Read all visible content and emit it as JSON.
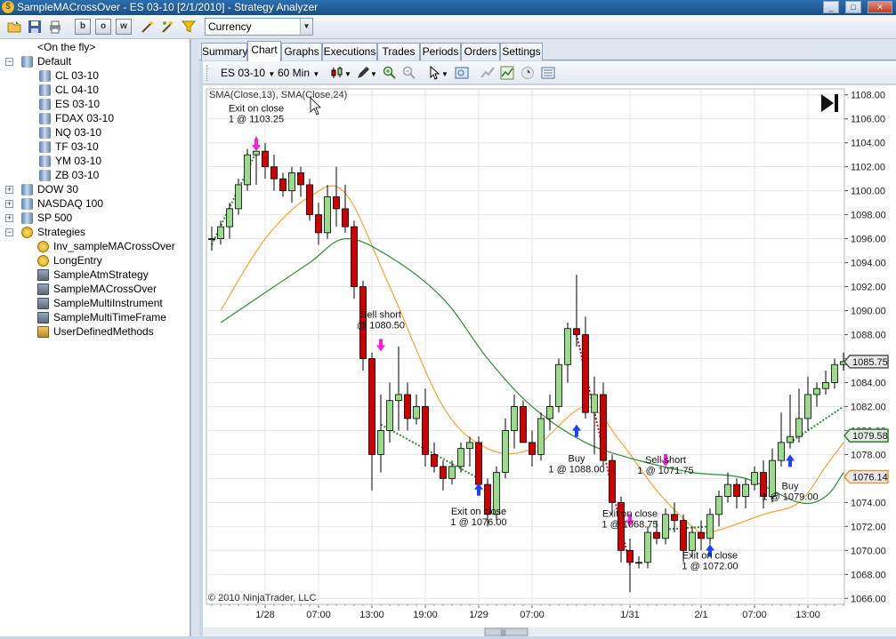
{
  "window": {
    "title": "SampleMACrossOver - ES 03-10 [2/1/2010] - Strategy Analyzer"
  },
  "toolbar": {
    "format_b": "b",
    "format_o": "o",
    "format_w": "w",
    "currency_select": "Currency"
  },
  "tree": [
    {
      "label": "<On the fly>",
      "level": 1,
      "icon": "db-icon",
      "expander": ""
    },
    {
      "label": "Default",
      "level": 0,
      "icon": "db-icon",
      "expander": "−"
    },
    {
      "label": "CL 03-10",
      "level": 2,
      "icon": "db-icon",
      "expander": ""
    },
    {
      "label": "CL 04-10",
      "level": 2,
      "icon": "db-icon",
      "expander": ""
    },
    {
      "label": "ES 03-10",
      "level": 2,
      "icon": "db-icon",
      "expander": ""
    },
    {
      "label": "FDAX 03-10",
      "level": 2,
      "icon": "db-icon",
      "expander": ""
    },
    {
      "label": "NQ 03-10",
      "level": 2,
      "icon": "db-icon",
      "expander": ""
    },
    {
      "label": "TF 03-10",
      "level": 2,
      "icon": "db-icon",
      "expander": ""
    },
    {
      "label": "YM 03-10",
      "level": 2,
      "icon": "db-icon",
      "expander": ""
    },
    {
      "label": "ZB 03-10",
      "level": 2,
      "icon": "db-icon",
      "expander": ""
    },
    {
      "label": "DOW 30",
      "level": 0,
      "icon": "db-icon",
      "expander": "+"
    },
    {
      "label": "NASDAQ 100",
      "level": 0,
      "icon": "db-icon",
      "expander": "+"
    },
    {
      "label": "SP 500",
      "level": 0,
      "icon": "db-icon",
      "expander": "+"
    },
    {
      "label": "Strategies",
      "level": 0,
      "icon": "coin-icon",
      "expander": "−"
    },
    {
      "label": "Inv_sampleMACrossOver",
      "level": 1,
      "icon": "coin-icon",
      "expander": ""
    },
    {
      "label": "LongEntry",
      "level": 1,
      "icon": "coin-icon",
      "expander": ""
    },
    {
      "label": "SampleAtmStrategy",
      "level": 1,
      "icon": "strategy-icon",
      "expander": ""
    },
    {
      "label": "SampleMACrossOver",
      "level": 1,
      "icon": "strategy-icon",
      "expander": ""
    },
    {
      "label": "SampleMultiInstrument",
      "level": 1,
      "icon": "strategy-icon",
      "expander": ""
    },
    {
      "label": "SampleMultiTimeFrame",
      "level": 1,
      "icon": "strategy-icon",
      "expander": ""
    },
    {
      "label": "UserDefinedMethods",
      "level": 1,
      "icon": "box-icon",
      "expander": ""
    }
  ],
  "tabs": [
    "Summary",
    "Chart",
    "Graphs",
    "Executions",
    "Trades",
    "Periods",
    "Orders",
    "Settings"
  ],
  "active_tab": "Chart",
  "chart_toolbar": {
    "instrument": "ES 03-10",
    "interval": "60 Min"
  },
  "chart_data": {
    "type": "candlestick",
    "indicator_label": "SMA(Close,13), SMA(Close,24)",
    "copyright": "© 2010 NinjaTrader, LLC",
    "ylim": [
      1065.5,
      1108.5
    ],
    "y_ticks": [
      "1066.00",
      "1068.00",
      "1070.00",
      "1072.00",
      "1074.00",
      "1076.00",
      "1078.00",
      "1080.00",
      "1082.00",
      "1084.00",
      "1086.00",
      "1088.00",
      "1090.00",
      "1092.00",
      "1094.00",
      "1096.00",
      "1098.00",
      "1100.00",
      "1102.00",
      "1104.00",
      "1106.00",
      "1108.00"
    ],
    "x_ticks": [
      {
        "bar": 6,
        "label": "1/28"
      },
      {
        "bar": 12,
        "label": "07:00"
      },
      {
        "bar": 18,
        "label": "13:00"
      },
      {
        "bar": 24,
        "label": "19:00"
      },
      {
        "bar": 30,
        "label": "1/29"
      },
      {
        "bar": 36,
        "label": "07:00"
      },
      {
        "bar": 47,
        "label": "1/31"
      },
      {
        "bar": 55,
        "label": "2/1"
      },
      {
        "bar": 61,
        "label": "07:00"
      },
      {
        "bar": 67,
        "label": "13:00"
      }
    ],
    "price_badges": [
      {
        "value": 1085.75,
        "label": "1085.75",
        "color": "#555555"
      },
      {
        "value": 1079.58,
        "label": "1079.58",
        "color": "#2e7d32"
      },
      {
        "value": 1076.14,
        "label": "1076.14",
        "color": "#ef9a1e"
      }
    ],
    "candles": [
      [
        1096.0,
        1097.0,
        1095.0,
        1096.0
      ],
      [
        1096.0,
        1097.5,
        1095.5,
        1097.0
      ],
      [
        1097.0,
        1099.0,
        1096.0,
        1098.5
      ],
      [
        1098.5,
        1101.0,
        1098.0,
        1100.5
      ],
      [
        1100.5,
        1103.5,
        1100.0,
        1103.0
      ],
      [
        1103.0,
        1104.5,
        1100.5,
        1103.3
      ],
      [
        1103.3,
        1104.0,
        1101.0,
        1102.0
      ],
      [
        1102.0,
        1103.0,
        1100.0,
        1101.0
      ],
      [
        1101.0,
        1101.5,
        1099.5,
        1100.0
      ],
      [
        1100.0,
        1102.0,
        1099.0,
        1101.5
      ],
      [
        1101.5,
        1102.0,
        1099.5,
        1100.5
      ],
      [
        1100.5,
        1101.0,
        1097.5,
        1098.0
      ],
      [
        1098.0,
        1099.0,
        1095.5,
        1096.5
      ],
      [
        1096.5,
        1100.5,
        1096.0,
        1099.5
      ],
      [
        1099.5,
        1102.0,
        1097.0,
        1098.5
      ],
      [
        1098.5,
        1100.5,
        1096.5,
        1097.0
      ],
      [
        1097.0,
        1097.5,
        1091.0,
        1092.0
      ],
      [
        1092.0,
        1092.5,
        1085.0,
        1086.0
      ],
      [
        1086.0,
        1086.5,
        1075.0,
        1078.0
      ],
      [
        1078.0,
        1083.0,
        1076.5,
        1080.0
      ],
      [
        1080.0,
        1084.0,
        1079.0,
        1082.5
      ],
      [
        1082.5,
        1087.0,
        1080.0,
        1083.0
      ],
      [
        1083.0,
        1084.0,
        1080.0,
        1081.0
      ],
      [
        1081.0,
        1083.0,
        1080.5,
        1082.0
      ],
      [
        1082.0,
        1083.5,
        1077.0,
        1078.0
      ],
      [
        1078.0,
        1079.0,
        1076.5,
        1077.0
      ],
      [
        1077.0,
        1077.5,
        1075.0,
        1076.0
      ],
      [
        1076.0,
        1077.5,
        1075.5,
        1077.0
      ],
      [
        1077.0,
        1079.0,
        1076.5,
        1078.5
      ],
      [
        1078.5,
        1079.5,
        1077.0,
        1079.0
      ],
      [
        1079.0,
        1079.5,
        1075.5,
        1075.5
      ],
      [
        1075.5,
        1076.0,
        1072.0,
        1073.0
      ],
      [
        1073.0,
        1077.0,
        1072.5,
        1076.5
      ],
      [
        1076.5,
        1081.0,
        1076.0,
        1080.0
      ],
      [
        1080.0,
        1083.0,
        1078.5,
        1082.0
      ],
      [
        1082.0,
        1082.5,
        1079.0,
        1079.0
      ],
      [
        1079.0,
        1080.0,
        1077.0,
        1078.0
      ],
      [
        1078.0,
        1081.5,
        1077.5,
        1081.0
      ],
      [
        1081.0,
        1083.0,
        1080.0,
        1082.0
      ],
      [
        1082.0,
        1086.0,
        1081.5,
        1085.5
      ],
      [
        1085.5,
        1089.0,
        1084.0,
        1088.5
      ],
      [
        1088.5,
        1093.0,
        1087.0,
        1088.0
      ],
      [
        1088.0,
        1089.5,
        1081.0,
        1081.5
      ],
      [
        1081.5,
        1084.5,
        1078.0,
        1083.0
      ],
      [
        1083.0,
        1084.0,
        1077.0,
        1077.5
      ],
      [
        1077.5,
        1078.0,
        1073.0,
        1074.0
      ],
      [
        1074.0,
        1074.5,
        1069.0,
        1070.0
      ],
      [
        1070.0,
        1071.0,
        1066.5,
        1069.0
      ],
      [
        1069.0,
        1069.5,
        1068.5,
        1069.0
      ],
      [
        1069.0,
        1072.0,
        1068.5,
        1071.5
      ],
      [
        1071.5,
        1072.5,
        1070.5,
        1071.0
      ],
      [
        1071.0,
        1073.5,
        1070.5,
        1073.0
      ],
      [
        1073.0,
        1074.0,
        1071.5,
        1072.5
      ],
      [
        1072.5,
        1073.0,
        1069.0,
        1070.0
      ],
      [
        1070.0,
        1072.0,
        1069.5,
        1071.5
      ],
      [
        1071.5,
        1072.5,
        1070.0,
        1071.0
      ],
      [
        1071.0,
        1073.5,
        1070.5,
        1073.0
      ],
      [
        1073.0,
        1075.0,
        1072.0,
        1074.5
      ],
      [
        1074.5,
        1076.5,
        1074.0,
        1075.5
      ],
      [
        1075.5,
        1076.0,
        1073.5,
        1074.5
      ],
      [
        1074.5,
        1076.0,
        1073.5,
        1075.5
      ],
      [
        1075.5,
        1077.0,
        1075.0,
        1076.5
      ],
      [
        1076.5,
        1077.5,
        1073.5,
        1074.5
      ],
      [
        1074.5,
        1078.5,
        1074.0,
        1077.5
      ],
      [
        1077.5,
        1081.5,
        1077.0,
        1079.0
      ],
      [
        1079.0,
        1083.0,
        1078.5,
        1079.5
      ],
      [
        1079.5,
        1083.5,
        1079.0,
        1081.0
      ],
      [
        1081.0,
        1084.5,
        1080.0,
        1083.0
      ],
      [
        1083.0,
        1084.0,
        1082.0,
        1083.5
      ],
      [
        1083.5,
        1085.0,
        1083.0,
        1084.0
      ],
      [
        1084.0,
        1086.0,
        1083.5,
        1085.5
      ],
      [
        1085.5,
        1086.5,
        1085.0,
        1085.75
      ]
    ],
    "series": [
      {
        "name": "SMA(Close,13)",
        "color": "#f0a535",
        "points": [
          [
            1,
            1090.0
          ],
          [
            6,
            1096.0
          ],
          [
            11,
            1099.5
          ],
          [
            15,
            1099.8
          ],
          [
            20,
            1092.0
          ],
          [
            26,
            1082.0
          ],
          [
            31,
            1078.5
          ],
          [
            36,
            1078.5
          ],
          [
            42,
            1082.0
          ],
          [
            46,
            1079.0
          ],
          [
            50,
            1075.0
          ],
          [
            54,
            1072.0
          ],
          [
            56,
            1071.5
          ],
          [
            62,
            1073.0
          ],
          [
            66,
            1074.0
          ],
          [
            69,
            1077.0
          ],
          [
            71,
            1079.0
          ]
        ]
      },
      {
        "name": "SMA(Close,24)",
        "color": "#2e8b34",
        "points": [
          [
            1,
            1089.0
          ],
          [
            6,
            1091.5
          ],
          [
            11,
            1094.0
          ],
          [
            15,
            1096.0
          ],
          [
            20,
            1094.5
          ],
          [
            26,
            1091.0
          ],
          [
            31,
            1086.0
          ],
          [
            36,
            1082.0
          ],
          [
            42,
            1079.0
          ],
          [
            48,
            1077.5
          ],
          [
            54,
            1076.5
          ],
          [
            60,
            1076.0
          ],
          [
            66,
            1074.0
          ],
          [
            69,
            1074.5
          ],
          [
            71,
            1076.5
          ]
        ]
      }
    ],
    "trades": [
      {
        "from": 0,
        "from_price": 1095.5,
        "to": 5,
        "to_price": 1103.25
      },
      {
        "from": 19,
        "from_price": 1080.5,
        "to": 30,
        "to_price": 1076.0
      },
      {
        "from": 41,
        "from_price": 1088.0,
        "to": 47,
        "to_price": 1068.75
      },
      {
        "from": 51,
        "from_price": 1071.75,
        "to": 56,
        "to_price": 1072.0
      },
      {
        "from": 65,
        "from_price": 1079.0,
        "to": 71,
        "to_price": 1082.0
      }
    ],
    "annotations": [
      {
        "bar": 5,
        "price": 1103.3,
        "dir": "down",
        "color": "#ff1fd6",
        "lines": [
          "Exit on close",
          "1 @ 1103.25"
        ],
        "text_price": 1106.6
      },
      {
        "bar": 19,
        "price": 1086.6,
        "dir": "down",
        "color": "#ff1fd6",
        "lines": [
          "Sell short",
          "@ 1080.50"
        ],
        "text_price": 1089.4
      },
      {
        "bar": 30,
        "price": 1075.6,
        "dir": "up",
        "color": "#1e40ff",
        "lines": [
          "Exit on close",
          "1 @ 1076.00"
        ],
        "text_price": 1073.0
      },
      {
        "bar": 41,
        "price": 1080.5,
        "dir": "up",
        "color": "#1e40ff",
        "lines": [
          "Buy",
          "1 @ 1088.00"
        ],
        "text_price": 1077.4
      },
      {
        "bar": 47,
        "price": 1072.0,
        "dir": "down",
        "color": "#ff1fd6",
        "lines": [
          "Exit on close",
          "1 @ 1068.75"
        ],
        "text_price": 1072.8
      },
      {
        "bar": 51,
        "price": 1077.0,
        "dir": "down",
        "color": "#ff1fd6",
        "lines": [
          "Sell short",
          "1 @ 1071.75"
        ],
        "text_price": 1077.3
      },
      {
        "bar": 56,
        "price": 1070.5,
        "dir": "up",
        "color": "#1e40ff",
        "lines": [
          "Exit on close",
          "1 @ 1072.00"
        ],
        "text_price": 1069.3
      },
      {
        "bar": 65,
        "price": 1078.0,
        "dir": "up",
        "color": "#1e40ff",
        "lines": [
          "Buy",
          "1 @ 1079.00"
        ],
        "text_price": 1075.1
      }
    ]
  }
}
